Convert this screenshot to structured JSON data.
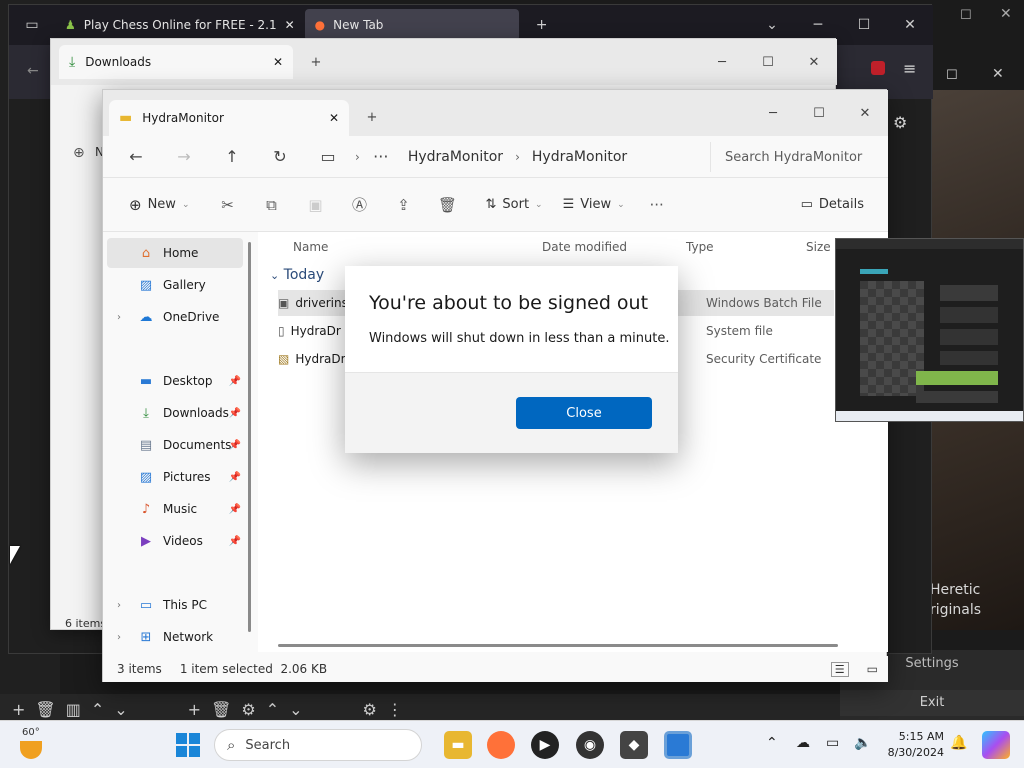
{
  "browser": {
    "tabs": [
      {
        "label": "Play Chess Online for FREE - 2.1"
      },
      {
        "label": "New Tab"
      }
    ],
    "new_tab": "+",
    "chevron": "⌄"
  },
  "background": {
    "photo_line1": "Heretic",
    "photo_line2": "riginals",
    "obs_settings": "Settings",
    "obs_exit": "Exit"
  },
  "downloads_window": {
    "tab_label": "Downloads",
    "nav_partial": "N",
    "status_partial": "6 items"
  },
  "explorer": {
    "tab_label": "HydraMonitor",
    "breadcrumb": [
      "HydraMonitor",
      "HydraMonitor"
    ],
    "search_placeholder": "Search HydraMonitor",
    "commands": {
      "new": "New",
      "sort": "Sort",
      "view": "View",
      "details": "Details"
    },
    "nav_items": [
      {
        "label": "Home",
        "icon": "home-icon"
      },
      {
        "label": "Gallery",
        "icon": "gallery-icon"
      },
      {
        "label": "OneDrive",
        "icon": "cloud-icon"
      },
      {
        "label": "Desktop",
        "icon": "desktop-icon"
      },
      {
        "label": "Downloads",
        "icon": "download-icon"
      },
      {
        "label": "Documents",
        "icon": "document-icon"
      },
      {
        "label": "Pictures",
        "icon": "pictures-icon"
      },
      {
        "label": "Music",
        "icon": "music-icon"
      },
      {
        "label": "Videos",
        "icon": "video-icon"
      },
      {
        "label": "This PC",
        "icon": "pc-icon"
      },
      {
        "label": "Network",
        "icon": "network-icon"
      }
    ],
    "columns": [
      "Name",
      "Date modified",
      "Type",
      "Size"
    ],
    "group_label": "Today",
    "files": [
      {
        "name": "driverins",
        "type": "Windows Batch File"
      },
      {
        "name": "HydraDr",
        "type": "System file"
      },
      {
        "name": "HydraDr",
        "type": "Security Certificate"
      }
    ],
    "status": {
      "count": "3 items",
      "selection": "1 item selected  2.06 KB"
    }
  },
  "dialog": {
    "title": "You're about to be signed out",
    "message": "Windows will shut down in less than a minute.",
    "close_label": "Close"
  },
  "taskbar": {
    "weather": "60°",
    "search_placeholder": "Search",
    "time": "5:15 AM",
    "date": "8/30/2024"
  },
  "colors": {
    "accent": "#0067c0",
    "taskbar": "#eef1f7"
  }
}
